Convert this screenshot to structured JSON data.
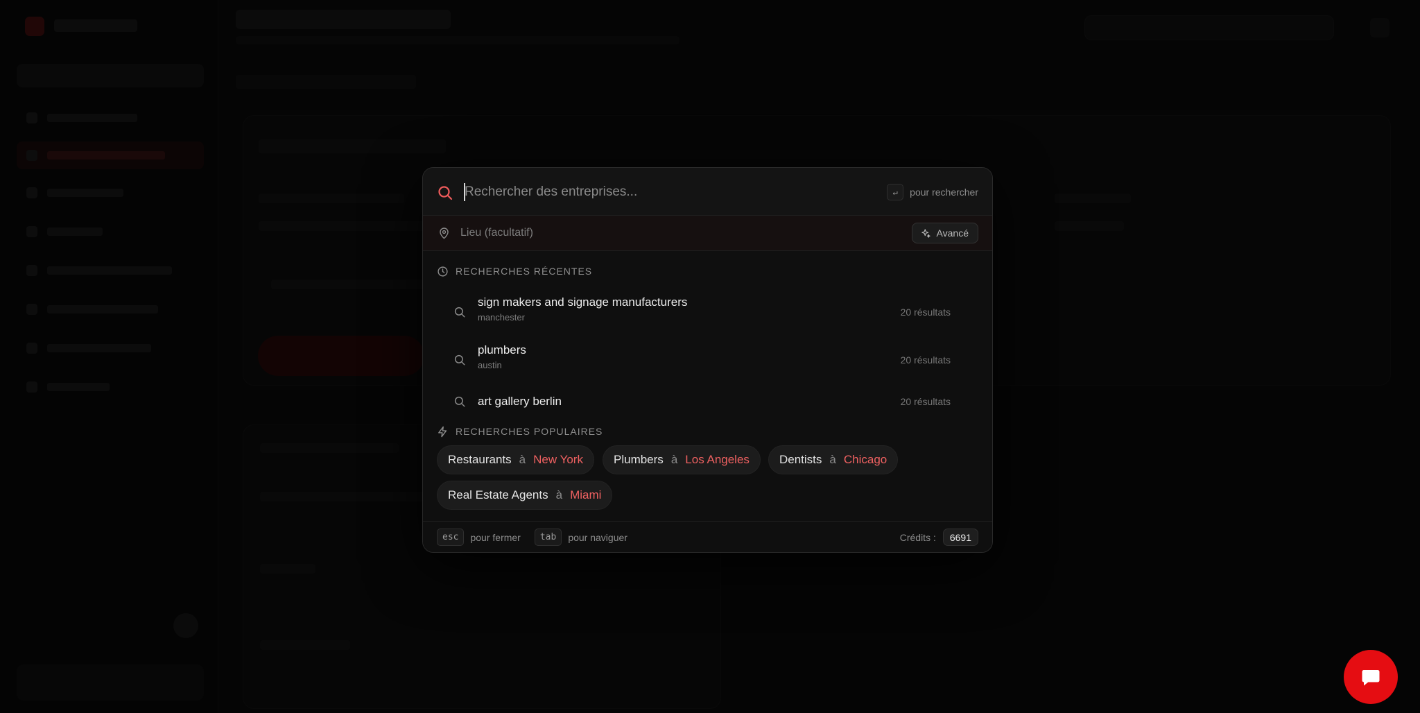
{
  "palette": {
    "search_placeholder": "Rechercher des entreprises...",
    "enter_key": "↵",
    "enter_hint": "pour rechercher",
    "location_placeholder": "Lieu (facultatif)",
    "advanced_label": "Avancé",
    "recent_heading": "RECHERCHES RÉCENTES",
    "recent": [
      {
        "title": "sign makers and signage manufacturers",
        "location": "manchester",
        "count": "20 résultats"
      },
      {
        "title": "plumbers",
        "location": "austin",
        "count": "20 résultats"
      },
      {
        "title": "art gallery berlin",
        "location": "",
        "count": "20 résultats"
      }
    ],
    "popular_heading": "RECHERCHES POPULAIRES",
    "popular": [
      {
        "term": "Restaurants",
        "sep": "à",
        "location": "New York"
      },
      {
        "term": "Plumbers",
        "sep": "à",
        "location": "Los Angeles"
      },
      {
        "term": "Dentists",
        "sep": "à",
        "location": "Chicago"
      },
      {
        "term": "Real Estate Agents",
        "sep": "à",
        "location": "Miami"
      }
    ],
    "footer": {
      "esc_key": "esc",
      "esc_hint": "pour fermer",
      "tab_key": "tab",
      "tab_hint": "pour naviguer",
      "credits_label": "Crédits :",
      "credits_value": "6691"
    }
  },
  "colors": {
    "accent": "#ef6161",
    "chat_button": "#e50d12",
    "palette_bg": "#0f0f0f"
  },
  "icons": {
    "search": "search-icon",
    "location": "map-pin-icon",
    "advanced": "sparkles-icon",
    "recent": "clock-icon",
    "popular": "lightning-icon",
    "chat": "chat-bubble-icon"
  }
}
